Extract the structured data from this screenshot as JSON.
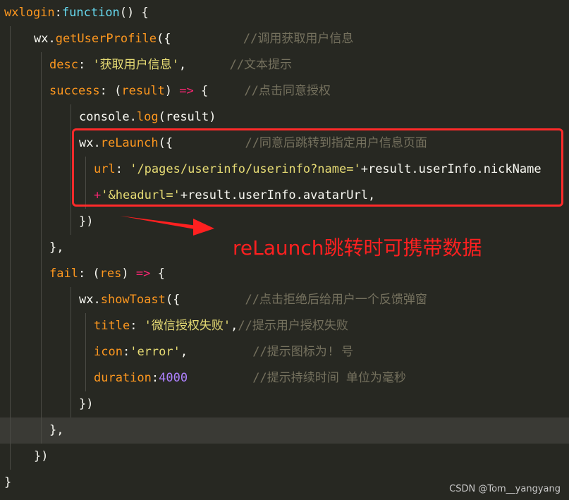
{
  "editor": {
    "lines": [
      {
        "indent": 0,
        "tokens": [
          {
            "t": "wxlogin",
            "c": "fn"
          },
          {
            "t": ":",
            "c": "punc"
          },
          {
            "t": "function",
            "c": "kw"
          },
          {
            "t": "() {",
            "c": "punc"
          }
        ]
      },
      {
        "indent": 1,
        "tokens": [
          {
            "t": "wx.",
            "c": "id"
          },
          {
            "t": "getUserProfile",
            "c": "fn"
          },
          {
            "t": "({",
            "c": "punc"
          },
          {
            "t": "          ",
            "c": "punc"
          },
          {
            "t": "//调用获取用户信息",
            "c": "com"
          }
        ]
      },
      {
        "indent": 2,
        "tokens": [
          {
            "t": "desc",
            "c": "prop"
          },
          {
            "t": ": ",
            "c": "punc"
          },
          {
            "t": "'获取用户信息'",
            "c": "str"
          },
          {
            "t": ",      ",
            "c": "punc"
          },
          {
            "t": "//文本提示",
            "c": "com"
          }
        ]
      },
      {
        "indent": 2,
        "tokens": [
          {
            "t": "success",
            "c": "fn"
          },
          {
            "t": ": (",
            "c": "punc"
          },
          {
            "t": "result",
            "c": "par"
          },
          {
            "t": ") ",
            "c": "punc"
          },
          {
            "t": "=>",
            "c": "op"
          },
          {
            "t": " {     ",
            "c": "punc"
          },
          {
            "t": "//点击同意授权",
            "c": "com"
          }
        ]
      },
      {
        "indent": 3,
        "tokens": [
          {
            "t": "console.",
            "c": "id"
          },
          {
            "t": "log",
            "c": "fn"
          },
          {
            "t": "(result)",
            "c": "punc"
          }
        ]
      },
      {
        "indent": 3,
        "tokens": [
          {
            "t": "wx.",
            "c": "id"
          },
          {
            "t": "reLaunch",
            "c": "fn"
          },
          {
            "t": "({",
            "c": "punc"
          },
          {
            "t": "          ",
            "c": "punc"
          },
          {
            "t": "//同意后跳转到指定用户信息页面",
            "c": "com"
          }
        ]
      },
      {
        "indent": 4,
        "tokens": [
          {
            "t": "url",
            "c": "prop"
          },
          {
            "t": ": ",
            "c": "punc"
          },
          {
            "t": "'/pages/userinfo/userinfo?name='",
            "c": "str"
          },
          {
            "t": "+result.userInfo.nickName",
            "c": "id"
          }
        ]
      },
      {
        "indent": 4,
        "tokens": [
          {
            "t": "+",
            "c": "op"
          },
          {
            "t": "'&headurl='",
            "c": "str"
          },
          {
            "t": "+result.userInfo.avatarUrl,",
            "c": "id"
          }
        ]
      },
      {
        "indent": 3,
        "tokens": [
          {
            "t": "})",
            "c": "punc"
          }
        ]
      },
      {
        "indent": 2,
        "tokens": [
          {
            "t": "},",
            "c": "punc"
          }
        ]
      },
      {
        "indent": 2,
        "tokens": [
          {
            "t": "fail",
            "c": "fn"
          },
          {
            "t": ": (",
            "c": "punc"
          },
          {
            "t": "res",
            "c": "par"
          },
          {
            "t": ") ",
            "c": "punc"
          },
          {
            "t": "=>",
            "c": "op"
          },
          {
            "t": " {",
            "c": "punc"
          }
        ]
      },
      {
        "indent": 3,
        "tokens": [
          {
            "t": "wx.",
            "c": "id"
          },
          {
            "t": "showToast",
            "c": "fn"
          },
          {
            "t": "({",
            "c": "punc"
          },
          {
            "t": "         ",
            "c": "punc"
          },
          {
            "t": "//点击拒绝后给用户一个反馈弹窗",
            "c": "com"
          }
        ]
      },
      {
        "indent": 4,
        "tokens": [
          {
            "t": "title",
            "c": "prop"
          },
          {
            "t": ": ",
            "c": "punc"
          },
          {
            "t": "'微信授权失败'",
            "c": "str"
          },
          {
            "t": ",",
            "c": "punc"
          },
          {
            "t": "//提示用户授权失败",
            "c": "com"
          }
        ]
      },
      {
        "indent": 4,
        "tokens": [
          {
            "t": "icon",
            "c": "prop"
          },
          {
            "t": ":",
            "c": "punc"
          },
          {
            "t": "'error'",
            "c": "str"
          },
          {
            "t": ",         ",
            "c": "punc"
          },
          {
            "t": "//提示图标为! 号",
            "c": "com"
          }
        ]
      },
      {
        "indent": 4,
        "tokens": [
          {
            "t": "duration",
            "c": "prop"
          },
          {
            "t": ":",
            "c": "punc"
          },
          {
            "t": "4000",
            "c": "num"
          },
          {
            "t": "         ",
            "c": "punc"
          },
          {
            "t": "//提示持续时间 单位为毫秒",
            "c": "com"
          }
        ]
      },
      {
        "indent": 3,
        "tokens": [
          {
            "t": "})",
            "c": "punc"
          }
        ]
      },
      {
        "indent": 2,
        "tokens": [
          {
            "t": "},",
            "c": "punc"
          }
        ],
        "current": true
      },
      {
        "indent": 1,
        "tokens": [
          {
            "t": "})",
            "c": "punc"
          }
        ]
      },
      {
        "indent": 0,
        "tokens": [
          {
            "t": "}",
            "c": "punc"
          }
        ]
      }
    ]
  },
  "annotation": {
    "text": "reLaunch跳转时可携带数据"
  },
  "watermark": "CSDN @Tom__yangyang",
  "colors": {
    "background": "#272822",
    "highlight_box": "#ff2a2a",
    "annotation": "#ff2020"
  }
}
